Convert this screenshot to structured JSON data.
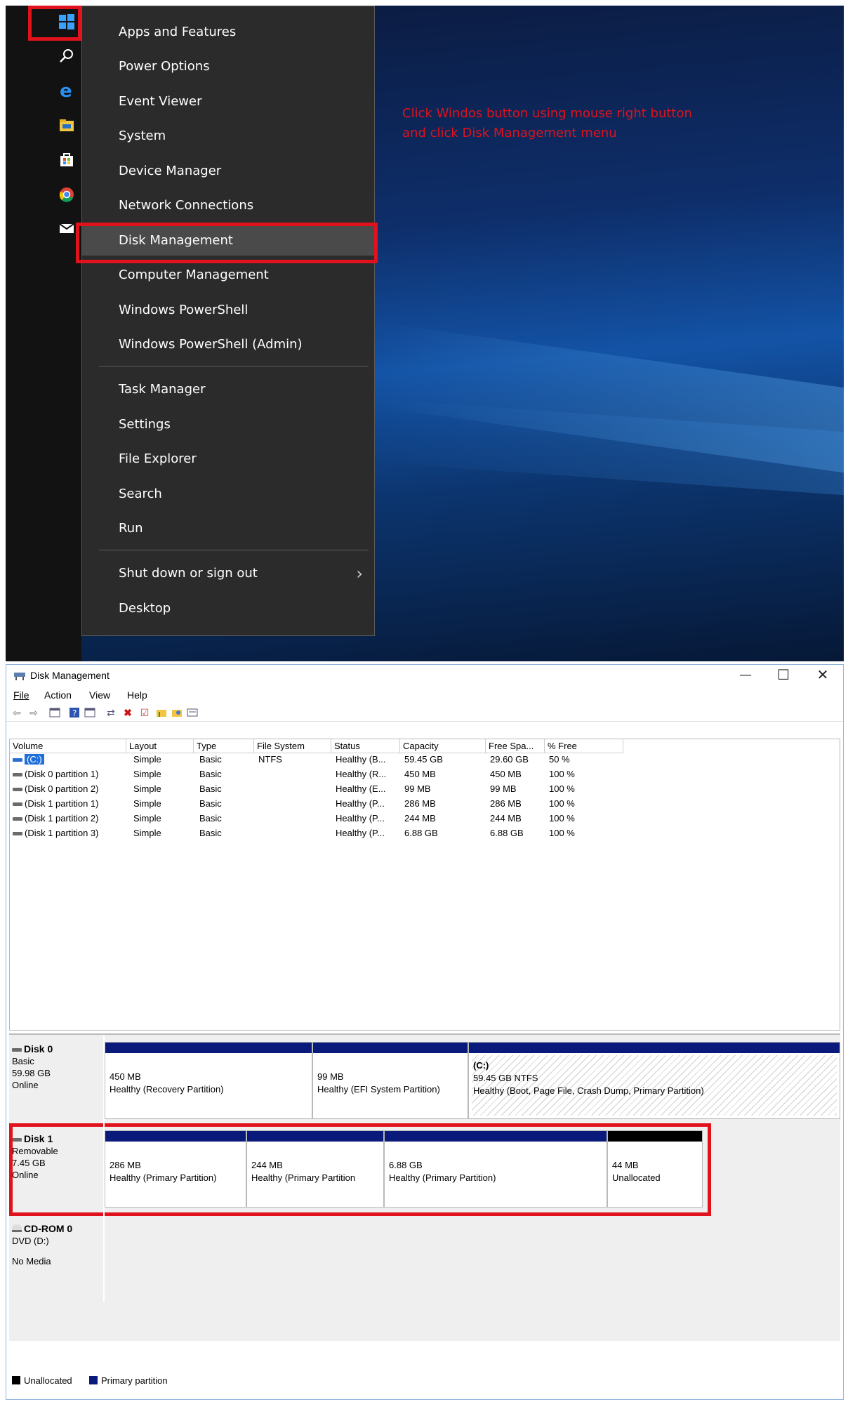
{
  "instruction": {
    "line1": "Click Windos button using mouse right button",
    "line2": "and click Disk Management menu"
  },
  "start_menu": {
    "items": [
      {
        "label": "Apps and Features"
      },
      {
        "label": "Power Options"
      },
      {
        "label": "Event Viewer"
      },
      {
        "label": "System"
      },
      {
        "label": "Device Manager"
      },
      {
        "label": "Network Connections"
      },
      {
        "label": "Disk Management",
        "highlighted": true
      },
      {
        "label": "Computer Management"
      },
      {
        "label": "Windows PowerShell"
      },
      {
        "label": "Windows PowerShell (Admin)"
      },
      {
        "label": "Task Manager"
      },
      {
        "label": "Settings"
      },
      {
        "label": "File Explorer"
      },
      {
        "label": "Search"
      },
      {
        "label": "Run"
      },
      {
        "label": "Shut down or sign out",
        "submenu_arrow": "›"
      },
      {
        "label": "Desktop"
      }
    ]
  },
  "taskbar_icons": [
    "windows-logo",
    "search",
    "edge",
    "file-explorer",
    "store",
    "chrome",
    "mail"
  ],
  "window": {
    "title": "Disk Management",
    "minimize": "—",
    "maximize": "☐",
    "close": "✕",
    "menu": [
      "File",
      "Action",
      "View",
      "Help"
    ]
  },
  "volume_table": {
    "headers": [
      "Volume",
      "Layout",
      "Type",
      "File System",
      "Status",
      "Capacity",
      "Free Spa...",
      "% Free"
    ],
    "rows": [
      [
        "(C:)",
        "Simple",
        "Basic",
        "NTFS",
        "Healthy (B...",
        "59.45 GB",
        "29.60 GB",
        "50 %"
      ],
      [
        "(Disk 0 partition 1)",
        "Simple",
        "Basic",
        "",
        "Healthy (R...",
        "450 MB",
        "450 MB",
        "100 %"
      ],
      [
        "(Disk 0 partition 2)",
        "Simple",
        "Basic",
        "",
        "Healthy (E...",
        "99 MB",
        "99 MB",
        "100 %"
      ],
      [
        "(Disk 1 partition 1)",
        "Simple",
        "Basic",
        "",
        "Healthy (P...",
        "286 MB",
        "286 MB",
        "100 %"
      ],
      [
        "(Disk 1 partition 2)",
        "Simple",
        "Basic",
        "",
        "Healthy (P...",
        "244 MB",
        "244 MB",
        "100 %"
      ],
      [
        "(Disk 1 partition 3)",
        "Simple",
        "Basic",
        "",
        "Healthy (P...",
        "6.88 GB",
        "6.88 GB",
        "100 %"
      ]
    ]
  },
  "disks": {
    "disk0": {
      "name": "Disk 0",
      "type": "Basic",
      "size": "59.98 GB",
      "state": "Online",
      "partitions": [
        {
          "size": "450 MB",
          "status": "Healthy (Recovery Partition)"
        },
        {
          "size": "99 MB",
          "status": "Healthy (EFI System Partition)"
        },
        {
          "label": "(C:)",
          "size": "59.45 GB NTFS",
          "status": "Healthy (Boot, Page File, Crash Dump, Primary Partition)"
        }
      ]
    },
    "disk1": {
      "name": "Disk 1",
      "type": "Removable",
      "size": "7.45 GB",
      "state": "Online",
      "partitions": [
        {
          "size": "286 MB",
          "status": "Healthy (Primary Partition)"
        },
        {
          "size": "244 MB",
          "status": "Healthy (Primary Partition"
        },
        {
          "size": "6.88 GB",
          "status": "Healthy (Primary Partition)"
        },
        {
          "size": "44 MB",
          "status": "Unallocated"
        }
      ]
    },
    "cdrom0": {
      "name": "CD-ROM 0",
      "type": "DVD (D:)",
      "state": "No Media"
    }
  },
  "legend": {
    "unallocated": "Unallocated",
    "primary": "Primary partition"
  },
  "colors": {
    "highlight_red": "#e0121c",
    "primary_partition": "#0a1a7a",
    "unallocated": "#000000",
    "menu_bg": "#2b2b2b"
  }
}
